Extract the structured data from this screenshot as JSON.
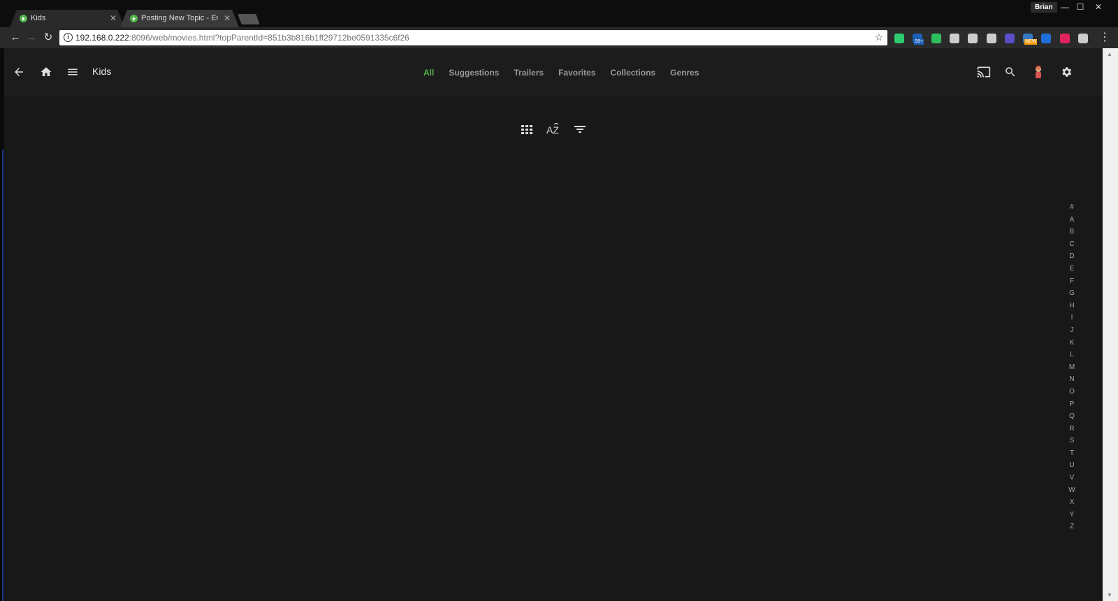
{
  "browser": {
    "tabs": [
      {
        "title": "Kids",
        "active": true
      },
      {
        "title": "Posting New Topic - Emb",
        "active": false
      }
    ],
    "profile_name": "Brian",
    "url_host": "192.168.0.222",
    "url_rest": ":8096/web/movies.html?topParentId=851b3b816b1ff29712be0591335c6f26",
    "extensions": [
      {
        "icon": "shield-icon",
        "color": "#2ecc71"
      },
      {
        "icon": "pocket-icon",
        "color": "#1a5fb4",
        "badge": "99+"
      },
      {
        "icon": "evernote-icon",
        "color": "#2dbe60"
      },
      {
        "icon": "qr-code-icon",
        "color": "#cccccc"
      },
      {
        "icon": "extension-icon",
        "color": "#cccccc"
      },
      {
        "icon": "extension-icon",
        "color": "#cccccc"
      },
      {
        "icon": "circle-icon",
        "color": "#5b4fc9"
      },
      {
        "icon": "new-extension-icon",
        "color": "#3478c6",
        "badge": "NEW"
      },
      {
        "icon": "square-extension-icon",
        "color": "#1e6fd9"
      },
      {
        "icon": "record-icon",
        "color": "#e0245e"
      },
      {
        "icon": "user-extension-icon",
        "color": "#cccccc"
      }
    ]
  },
  "app": {
    "title": "Kids",
    "accent": "#52b54b",
    "nav_tabs": [
      "All",
      "Suggestions",
      "Trailers",
      "Favorites",
      "Collections",
      "Genres"
    ],
    "active_tab": "All",
    "alphabet": [
      "#",
      "A",
      "B",
      "C",
      "D",
      "E",
      "F",
      "G",
      "H",
      "I",
      "J",
      "K",
      "L",
      "M",
      "N",
      "O",
      "P",
      "Q",
      "R",
      "S",
      "T",
      "U",
      "V",
      "W",
      "X",
      "Y",
      "Z"
    ]
  }
}
